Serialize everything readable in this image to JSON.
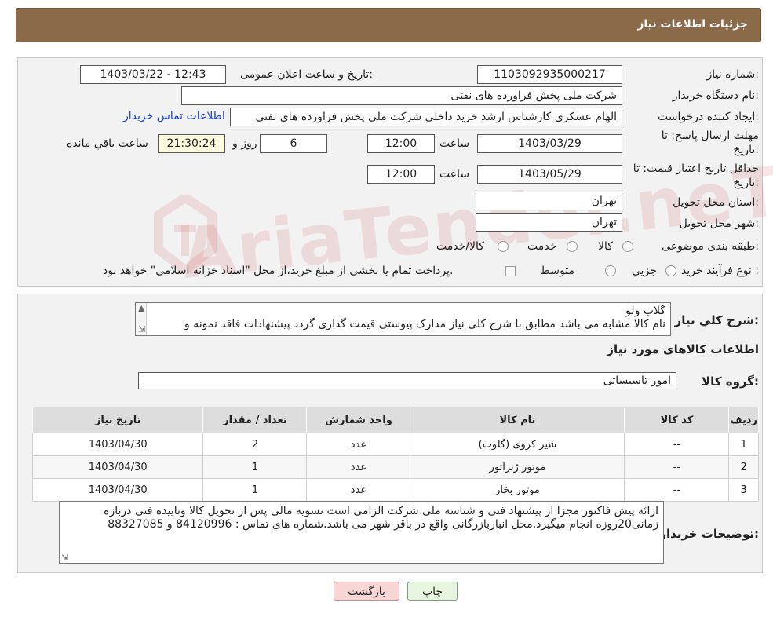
{
  "header": {
    "title": "جزئیات اطلاعات نیاز"
  },
  "form": {
    "need_number_label": "شماره نیاز:",
    "need_number": "1103092935000217",
    "announce_label": "تاریخ و ساعت اعلان عمومی:",
    "announce_value": "1403/03/22 - 12:43",
    "buyer_org_label": "نام دستگاه خریدار:",
    "buyer_org": "شرکت ملی پخش فراورده های نفتی",
    "creator_label": "ایجاد کننده درخواست:",
    "creator": "الهام عسکری کارشناس ارشد خرید داخلی شرکت ملی پخش فراورده های نفتی",
    "contact_link": "اطلاعات تماس خریدار",
    "deadline_label_1": "مهلت ارسال پاسخ: تا",
    "deadline_label_2": "تاریخ:",
    "deadline_date": "1403/03/29",
    "time_label": "ساعت",
    "deadline_time": "12:00",
    "days_value": "6",
    "days_label": "روز و",
    "remaining_time": "21:30:24",
    "remaining_label": "ساعت باقي مانده",
    "validity_label_1": "حداقل تاریخ اعتبار قیمت: تا",
    "validity_label_2": "تاریخ:",
    "validity_date": "1403/05/29",
    "validity_time": "12:00",
    "province_label": "استان محل تحویل:",
    "province": "تهران",
    "city_label": "شهر محل تحویل:",
    "city": "تهران",
    "category_label": "طبقه بندی موضوعی:",
    "category_options": [
      "کالا",
      "خدمت",
      "کالا/خدمت"
    ],
    "process_label": "نوع فرآیند خرید :",
    "process_options": [
      "جزیي",
      "متوسط"
    ],
    "process_note": "پرداخت تمام یا بخشی از مبلغ خرید،از محل \"اسناد خزانه اسلامی\" خواهد بود."
  },
  "watermark": "AriaTender.neT",
  "summary": {
    "label": "شرح كلي نياز:",
    "line1": "گلاب ولو",
    "line2": "نام کالا مشابه می باشد مطابق با شرح کلی نیاز مدارک پیوستی قیمت گذاری گردد پیشنهادات فاقد نمونه و"
  },
  "items_section": {
    "title": "اطلاعات کالاهای مورد نیاز",
    "group_label": "گروه کالا:",
    "group_value": "امور تاسیساتی"
  },
  "table": {
    "headers": [
      "ردیف",
      "کد کالا",
      "نام کالا",
      "واحد شمارش",
      "تعداد / مقدار",
      "تاریخ نیاز"
    ],
    "rows": [
      [
        "1",
        "--",
        "شیر کروی (گلوب)",
        "عدد",
        "2",
        "1403/04/30"
      ],
      [
        "2",
        "--",
        "موتور ژنراتور",
        "عدد",
        "1",
        "1403/04/30"
      ],
      [
        "3",
        "--",
        "موتور بخار",
        "عدد",
        "1",
        "1403/04/30"
      ]
    ]
  },
  "buyer_notes": {
    "label": "توضیحات خریدار:",
    "line1": "ارائه پیش فاکتور مجزا از پیشنهاد فنی و شناسه ملی شرکت الزامی است تسویه مالی پس از تحویل کالا وتاییده فنی دربازه",
    "line2": "زمانی20روزه انجام میگیرد.محل انبارباز‌رگانی واقع در باقر شهر می باشد.شماره های تماس : 84120996 و 88327085"
  },
  "buttons": {
    "print": "چاپ",
    "back": "بازگشت"
  },
  "colors": {
    "header": "#8b6a4a",
    "back_button": "#f9d6d6",
    "print_button": "#e8f5e0",
    "link": "#1a3fd6"
  }
}
